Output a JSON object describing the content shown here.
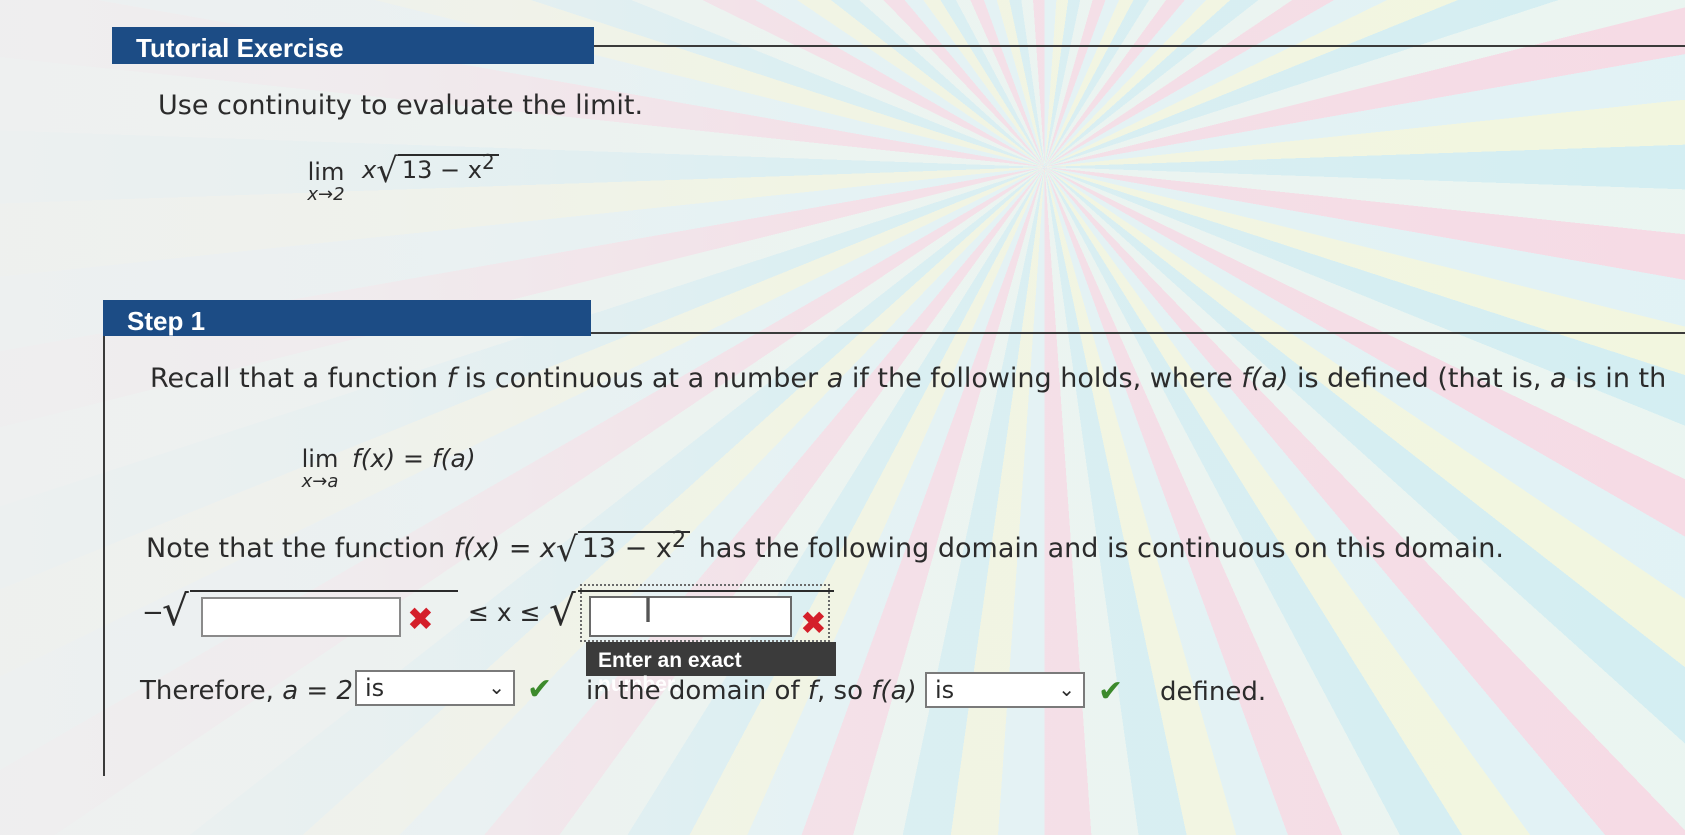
{
  "tutorial": {
    "title": "Tutorial Exercise"
  },
  "problem": {
    "instruction": "Use continuity to evaluate the limit.",
    "lim_word": "lim",
    "lim_sub": "x→2",
    "expr_prefix": "x",
    "radicand": "13 − x",
    "exp": "2"
  },
  "step1": {
    "title": "Step 1",
    "recall_text_a": "Recall that a function ",
    "recall_f": "f",
    "recall_text_b": " is continuous at a number ",
    "recall_a": "a",
    "recall_text_c": " if the following holds, where ",
    "recall_fa": "f(a)",
    "recall_text_d": " is defined (that is, ",
    "recall_a2": "a",
    "recall_text_e": " is in th",
    "def_lim": "lim",
    "def_sub": "x→a",
    "def_expr": "f(x) = f(a)",
    "note_a": "Note that the function ",
    "note_fx": "f(x) = x",
    "note_radicand": "13 − x",
    "note_exp": "2",
    "note_b": " has the following domain and is continuous on this domain.",
    "ineq": "≤ x ≤",
    "minus": "−",
    "input1_value": "",
    "input2_value": "",
    "tooltip": "Enter an exact number.",
    "therefore": "Therefore, ",
    "a_eq": "a = 2",
    "select1": "is",
    "in_domain": "in the domain of ",
    "f_of": "f",
    "so": ", so ",
    "fa": "f(a)",
    "select2": "is",
    "defined": "defined."
  },
  "colors": {
    "header": "#1c4c85",
    "wrong": "#d41f2a",
    "correct": "#3c8a2c"
  },
  "icons": [
    "x-mark-icon",
    "check-mark-icon",
    "chevron-down-icon",
    "text-cursor-icon"
  ]
}
